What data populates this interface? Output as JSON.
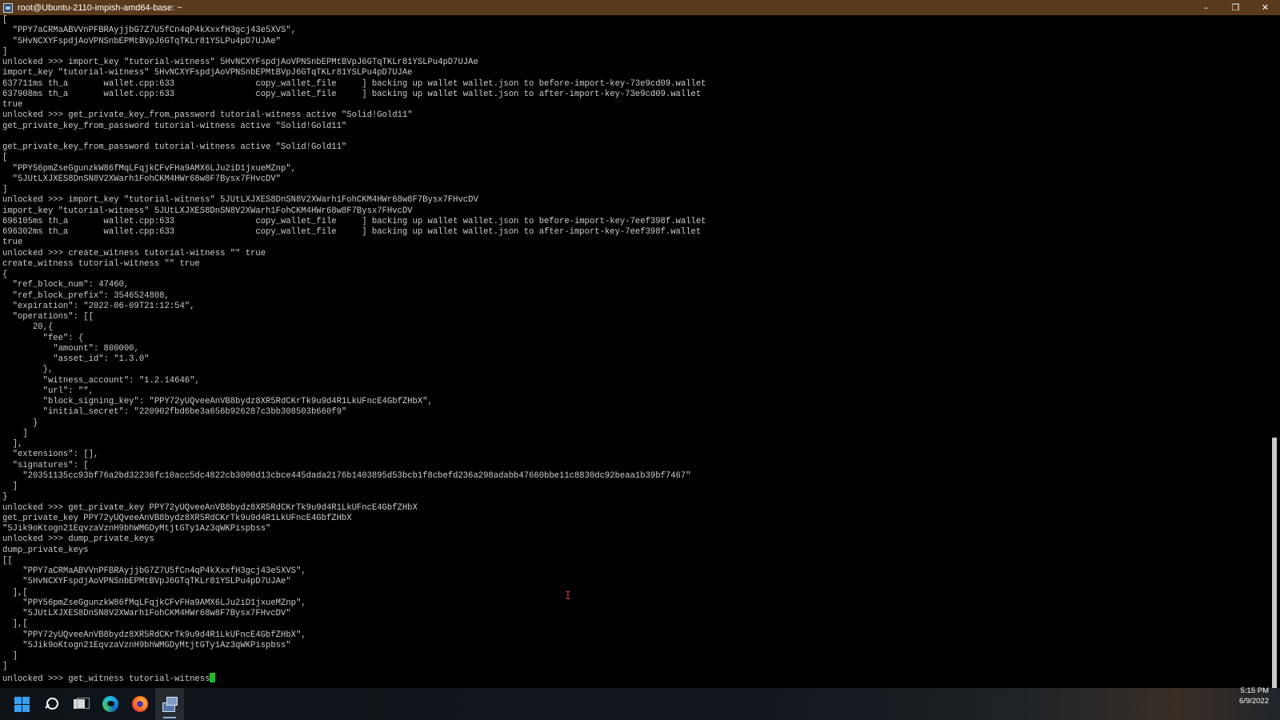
{
  "window": {
    "title": "root@Ubuntu-2110-impish-amd64-base: ~",
    "controls": {
      "minimize": "–",
      "maximize": "❐",
      "close": "✕"
    }
  },
  "terminal": {
    "lines": [
      "[",
      "  \"PPY7aCRMaABVVnPFBRAyjjbG7Z7U5fCn4qP4kXxxfH3gcj43e5XVS\",",
      "  \"5HvNCXYFspdjAoVPNSnbEPMtBVpJ6GTqTKLr81YSLPu4pD7UJAe\"",
      "]",
      "unlocked >>> import_key \"tutorial-witness\" 5HvNCXYFspdjAoVPNSnbEPMtBVpJ6GTqTKLr81YSLPu4pD7UJAe",
      "import_key \"tutorial-witness\" 5HvNCXYFspdjAoVPNSnbEPMtBVpJ6GTqTKLr81YSLPu4pD7UJAe",
      "637711ms th_a       wallet.cpp:633                copy_wallet_file     ] backing up wallet wallet.json to before-import-key-73e9cd09.wallet",
      "637908ms th_a       wallet.cpp:633                copy_wallet_file     ] backing up wallet wallet.json to after-import-key-73e9cd09.wallet",
      "true",
      "unlocked >>> get_private_key_from_password tutorial-witness active \"Solid!Gold11\"",
      "get_private_key_from_password tutorial-witness active \"Solid!Gold11\"",
      "",
      "get_private_key_from_password tutorial-witness active \"Solid!Gold11\"",
      "[",
      "  \"PPY56pmZseGgunzkW86fMqLFqjkCFvFHa9AMX6LJu2iD1jxueMZnp\",",
      "  \"5JUtLXJXES8DnSN8V2XWarh1FohCKM4HWr68w8F7Bysx7FHvcDV\"",
      "]",
      "unlocked >>> import_key \"tutorial-witness\" 5JUtLXJXES8DnSN8V2XWarh1FohCKM4HWr68w8F7Bysx7FHvcDV",
      "import_key \"tutorial-witness\" 5JUtLXJXES8DnSN8V2XWarh1FohCKM4HWr68w8F7Bysx7FHvcDV",
      "696105ms th_a       wallet.cpp:633                copy_wallet_file     ] backing up wallet wallet.json to before-import-key-7eef398f.wallet",
      "696302ms th_a       wallet.cpp:633                copy_wallet_file     ] backing up wallet wallet.json to after-import-key-7eef398f.wallet",
      "true",
      "unlocked >>> create_witness tutorial-witness \"\" true",
      "create_witness tutorial-witness \"\" true",
      "{",
      "  \"ref_block_num\": 47460,",
      "  \"ref_block_prefix\": 3546524808,",
      "  \"expiration\": \"2022-06-09T21:12:54\",",
      "  \"operations\": [[",
      "      20,{",
      "        \"fee\": {",
      "          \"amount\": 800000,",
      "          \"asset_id\": \"1.3.0\"",
      "        },",
      "        \"witness_account\": \"1.2.14646\",",
      "        \"url\": \"\",",
      "        \"block_signing_key\": \"PPY72yUQveeAnVB8bydz8XR5RdCKrTk9u9d4R1LkUFncE4GbfZHbX\",",
      "        \"initial_secret\": \"220902fbd6be3a656b926287c3bb308503b660f9\"",
      "      }",
      "    ]",
      "  ],",
      "  \"extensions\": [],",
      "  \"signatures\": [",
      "    \"20351135cc93bf76a2bd32236fc10acc5dc4822cb3000d13cbce445dada2176b1403895d53bcb1f8cbefd236a298adabb47660bbe11c8830dc92beaa1b39bf7467\"",
      "  ]",
      "}",
      "unlocked >>> get_private_key PPY72yUQveeAnVB8bydz8XR5RdCKrTk9u9d4R1LkUFncE4GbfZHbX",
      "get_private_key PPY72yUQveeAnVB8bydz8XR5RdCKrTk9u9d4R1LkUFncE4GbfZHbX",
      "\"5Jik9oKtogn21EqvzaVznH9bhWMGDyMtjtGTy1Az3qWKPispbss\"",
      "unlocked >>> dump_private_keys",
      "dump_private_keys",
      "[[",
      "    \"PPY7aCRMaABVVnPFBRAyjjbG7Z7U5fCn4qP4kXxxfH3gcj43e5XVS\",",
      "    \"5HvNCXYFspdjAoVPNSnbEPMtBVpJ6GTqTKLr81YSLPu4pD7UJAe\"",
      "  ],[",
      "    \"PPY56pmZseGgunzkW86fMqLFqjkCFvFHa9AMX6LJu2iD1jxueMZnp\",",
      "    \"5JUtLXJXES8DnSN8V2XWarh1FohCKM4HWr68w8F7Bysx7FHvcDV\"",
      "  ],[",
      "    \"PPY72yUQveeAnVB8bydz8XR5RdCKrTk9u9d4R1LkUFncE4GbfZHbX\",",
      "    \"5Jik9oKtogn21EqvzaVznH9bhWMGDyMtjtGTy1Az3qWKPispbss\"",
      "  ]",
      "]"
    ],
    "current_input": "unlocked >>> get_witness tutorial-witness",
    "cursor_color": "#13c21c",
    "mouse_ibeam": "I"
  },
  "scrollbar": {
    "position": 0.63
  },
  "taskbar": {
    "icons": [
      "windows-start-icon",
      "search-icon",
      "task-view-icon",
      "edge-browser-icon",
      "firefox-icon",
      "putty-icon"
    ],
    "accent": "#3aa0f3",
    "clock": {
      "time": "5:15 PM",
      "date": "6/9/2022"
    }
  }
}
